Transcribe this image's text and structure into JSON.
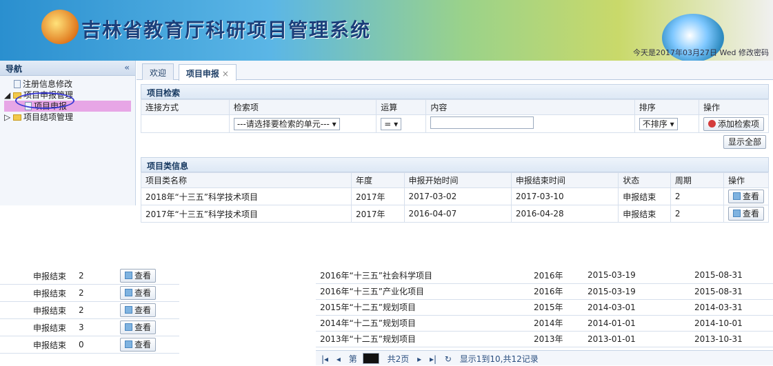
{
  "app": {
    "title": "吉林省教育厅科研项目管理系统",
    "status_text": "今天是2017年03月27日 Wed  修改密码"
  },
  "sidebar": {
    "header": "导航",
    "collapse": "«",
    "items": [
      {
        "label": "注册信息修改",
        "level": 2,
        "type": "file"
      },
      {
        "label": "项目申报管理",
        "level": 1,
        "type": "folder"
      },
      {
        "label": "项目申报",
        "level": 3,
        "type": "file",
        "selected": true
      },
      {
        "label": "项目结项管理",
        "level": 1,
        "type": "folder"
      }
    ]
  },
  "tabs": [
    {
      "label": "欢迎"
    },
    {
      "label": "项目申报",
      "close": "×"
    }
  ],
  "search": {
    "title": "项目检索",
    "headers": [
      "连接方式",
      "检索项",
      "运算",
      "内容",
      "排序",
      "操作"
    ],
    "field_select": "---请选择要检索的单元--- ▾",
    "op_select": "=  ▾",
    "sort_select": "不排序 ▾",
    "add_button": "添加检索项",
    "show_all_button": "显示全部"
  },
  "list": {
    "title": "项目类信息",
    "headers": [
      "项目类名称",
      "年度",
      "申报开始时间",
      "申报结束时间",
      "状态",
      "周期",
      "操作"
    ],
    "rows": [
      {
        "name": "2018年“十三五”科学技术项目",
        "year": "2017年",
        "start": "2017-03-02",
        "end": "2017-03-10",
        "status": "申报结束",
        "period": "2",
        "action": "查看"
      },
      {
        "name": "2017年“十三五”科学技术项目",
        "year": "2017年",
        "start": "2016-04-07",
        "end": "2016-04-28",
        "status": "申报结束",
        "period": "2",
        "action": "查看"
      }
    ]
  },
  "lower_rows": [
    {
      "name": "2016年“十三五”社会科学项目",
      "year": "2016年",
      "start": "2015-03-19",
      "end": "2015-08-31"
    },
    {
      "name": "2016年“十三五”产业化项目",
      "year": "2016年",
      "start": "2015-03-19",
      "end": "2015-08-31"
    },
    {
      "name": "2015年“十二五”规划项目",
      "year": "2015年",
      "start": "2014-03-01",
      "end": "2014-03-31"
    },
    {
      "name": "2014年“十二五”规划项目",
      "year": "2014年",
      "start": "2014-01-01",
      "end": "2014-10-01"
    },
    {
      "name": "2013年“十二五”规划项目",
      "year": "2013年",
      "start": "2013-01-01",
      "end": "2013-10-31"
    }
  ],
  "left_rows": [
    {
      "status": "申报结束",
      "period": "2",
      "action": "查看"
    },
    {
      "status": "申报结束",
      "period": "2",
      "action": "查看"
    },
    {
      "status": "申报结束",
      "period": "2",
      "action": "查看"
    },
    {
      "status": "申报结束",
      "period": "3",
      "action": "查看"
    },
    {
      "status": "申报结束",
      "period": "0",
      "action": "查看"
    }
  ],
  "pager": {
    "first": "|◂",
    "prev": "◂",
    "page_label": "第",
    "total_pages": "共2页",
    "next": "▸",
    "last": "▸|",
    "refresh": "↻",
    "summary": "显示1到10,共12记录"
  }
}
